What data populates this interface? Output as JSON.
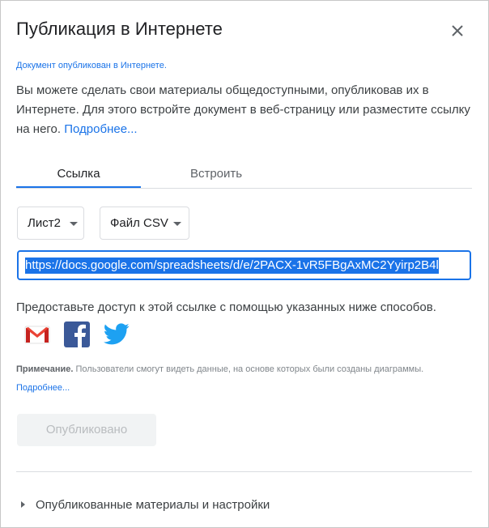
{
  "dialog": {
    "title": "Публикация в Интернете",
    "published_note": "Документ опубликован в Интернете.",
    "description": "Вы можете сделать свои материалы общедоступными, опубликовав их в Интернете. Для этого встройте документ в веб-страницу или разместите ссылку на него.",
    "learn_more": "Подробнее..."
  },
  "tabs": [
    {
      "label": "Ссылка",
      "active": true
    },
    {
      "label": "Встроить",
      "active": false
    }
  ],
  "selects": {
    "sheet": "Лист2",
    "format": "Файл CSV"
  },
  "url": {
    "value": "https://docs.google.com/spreadsheets/d/e/2PACX-1vR5FBgAxMC2Yyirp2B4l"
  },
  "share": {
    "text": "Предоставьте доступ к этой ссылке с помощью указанных ниже способов.",
    "icons": [
      "gmail-icon",
      "facebook-icon",
      "twitter-icon"
    ]
  },
  "note": {
    "label": "Примечание.",
    "text": " Пользователи смогут видеть данные, на основе которых были созданы диаграммы. ",
    "link": "Подробнее..."
  },
  "publish_button": "Опубликовано",
  "settings_label": "Опубликованные материалы и настройки",
  "colors": {
    "accent": "#1a73e8",
    "gmail_red": "#ea4335",
    "facebook_blue": "#3b5998",
    "twitter_blue": "#1da1f2"
  }
}
